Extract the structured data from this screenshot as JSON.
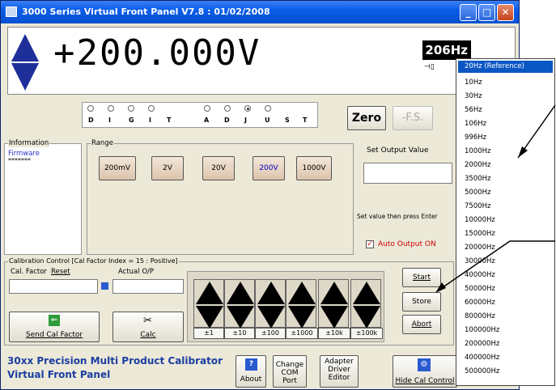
{
  "window": {
    "title": "3000 Series Virtual Front Panel V7.8 : 01/02/2008"
  },
  "display": {
    "value": "+200.000V",
    "frequency": "206Hz"
  },
  "digit_adjust": {
    "letters": [
      "D",
      "I",
      "G",
      "I",
      "T",
      "A",
      "D",
      "J",
      "U",
      "S",
      "T"
    ],
    "selected_index": 6
  },
  "buttons": {
    "zero": "Zero",
    "fs": "-F.S."
  },
  "information": {
    "label": "Information",
    "firmware_label": "Firmware",
    "firmware_value": "*******"
  },
  "range": {
    "label": "Range",
    "options": [
      "200mV",
      "2V",
      "20V",
      "200V",
      "1000V"
    ],
    "selected": "200V"
  },
  "output": {
    "set_label": "Set Output Value",
    "hint": "Set value then press Enter",
    "auto_label": "Auto Output ON",
    "auto_checked": true
  },
  "calibration": {
    "title": "Calibration Control [Cal Factor Index = 15 : Positive]",
    "cal_factor_label": "Cal. Factor",
    "reset": "Reset",
    "actual_label": "Actual O/P",
    "send_label": "Send Cal Factor",
    "calc_label": "Calc",
    "steps": [
      "±1",
      "±10",
      "±100",
      "±1000",
      "±10k",
      "±100k"
    ],
    "start": "Start",
    "store": "Store",
    "abort": "Abort"
  },
  "footer": {
    "brand_line1": "30xx Precision Multi Product Calibrator",
    "brand_line2": "Virtual Front Panel",
    "about": "About",
    "com_port": "Change COM Port",
    "adapter": "Adapter Driver Editor",
    "hide_cal": "Hide Cal Control"
  },
  "frequency_menu": {
    "selected": "20Hz (Reference)",
    "options": [
      "10Hz",
      "30Hz",
      "56Hz",
      "106Hz",
      "996Hz",
      "1000Hz",
      "2000Hz",
      "3500Hz",
      "5000Hz",
      "7500Hz",
      "10000Hz",
      "15000Hz",
      "20000Hz",
      "30000Hz",
      "40000Hz",
      "50000Hz",
      "60000Hz",
      "80000Hz",
      "100000Hz",
      "200000Hz",
      "400000Hz",
      "500000Hz"
    ]
  },
  "colors": {
    "title_bar": "#0a5ce8",
    "accent_blue": "#1a3ea0",
    "selection": "#0a56c4",
    "display_black": "#000000"
  }
}
